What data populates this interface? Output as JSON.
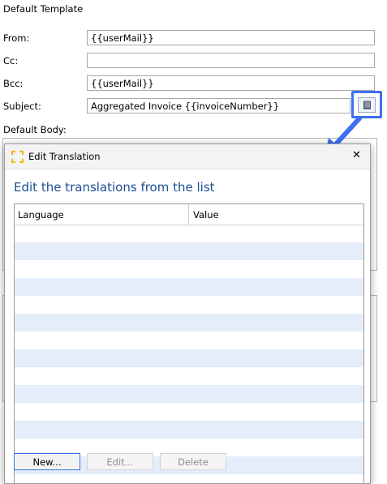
{
  "section_title": "Default Template",
  "fields": {
    "from": {
      "label": "From:",
      "value": "{{userMail}}"
    },
    "cc": {
      "label": "Cc:",
      "value": ""
    },
    "bcc": {
      "label": "Bcc:",
      "value": "{{userMail}}"
    },
    "subject": {
      "label": "Subject:",
      "value": "Aggregated Invoice {{invoiceNumber}}"
    }
  },
  "body_label": "Default Body:",
  "dialog": {
    "title": "Edit Translation",
    "close_glyph": "✕",
    "heading": "Edit the translations from the list",
    "columns": [
      "Language",
      "Value"
    ],
    "buttons": {
      "new": "New...",
      "edit": "Edit...",
      "delete": "Delete"
    }
  },
  "colors": {
    "heading": "#1d4c93",
    "annotation": "#3d6ff0",
    "row_alt": "#e4edf9",
    "app_icon": "#f2b705"
  },
  "icons": {
    "translate_button": "book-icon",
    "dialog_app": "app-logo-icon",
    "annotation": "arrow-annotation"
  }
}
